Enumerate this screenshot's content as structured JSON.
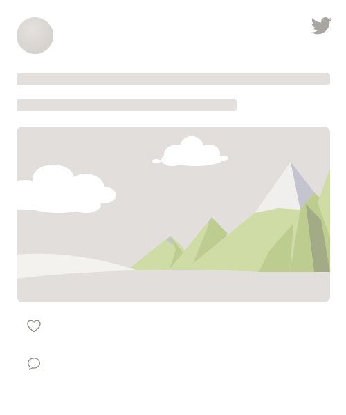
{
  "post": {
    "author": {
      "avatar_icon": "avatar-placeholder"
    },
    "brand": {
      "icon": "twitter-bird-icon",
      "color": "#a9a6a2"
    },
    "skeleton": {
      "color": "#e2dfdc"
    },
    "media": {
      "icon": "landscape-placeholder",
      "colors": {
        "sky": "#e1dedb",
        "cloud": "#ffffff",
        "mountain_light": "#cfdca6",
        "mountain_mid": "#bccd8f",
        "mountain_dark": "#a3aa86",
        "snow": "#f1efed",
        "snow_shadow": "#c4c4cf",
        "ground": "#e1dedb",
        "ground_light": "#f4f2ee"
      }
    },
    "actions": {
      "like": {
        "icon": "heart-icon",
        "count": ""
      },
      "reply": {
        "icon": "speech-bubble-icon",
        "count": ""
      }
    }
  }
}
